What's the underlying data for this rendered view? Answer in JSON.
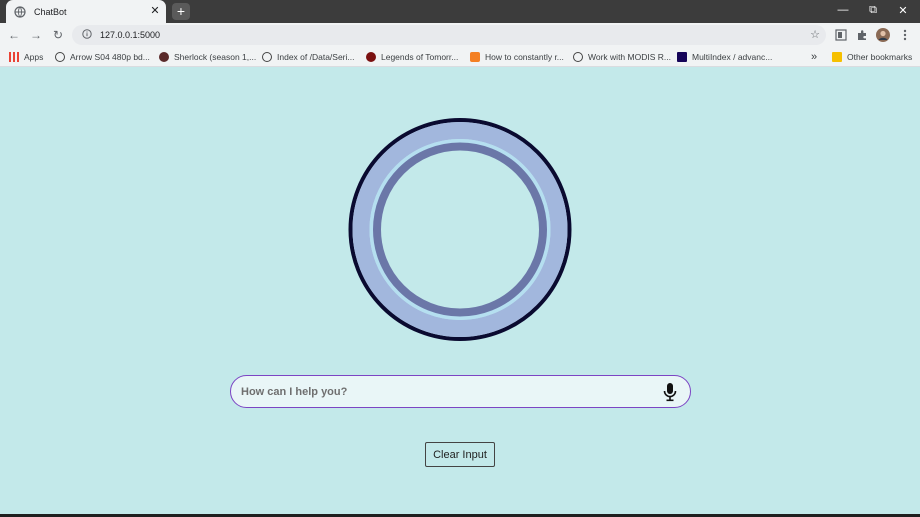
{
  "browser": {
    "tab_title": "ChatBot",
    "new_tab_symbol": "+",
    "url": "127.0.0.1:5000",
    "bookmarks": [
      {
        "label": "Apps",
        "icon": "apps-grid-icon"
      },
      {
        "label": "Arrow S04 480p bd...",
        "icon": "globe-icon"
      },
      {
        "label": "Sherlock (season 1,...",
        "icon": "site-icon"
      },
      {
        "label": "Index of /Data/Seri...",
        "icon": "globe-icon"
      },
      {
        "label": "Legends of Tomorr...",
        "icon": "site-icon"
      },
      {
        "label": "How to constantly r...",
        "icon": "stackoverflow-icon"
      },
      {
        "label": "Work with MODIS R...",
        "icon": "globe-icon"
      },
      {
        "label": "MultiIndex / advanc...",
        "icon": "pandas-icon"
      }
    ],
    "overflow_symbol": "»",
    "other_bookmarks": "Other bookmarks"
  },
  "app": {
    "search_placeholder": "How can I help you?",
    "clear_button": "Clear Input",
    "orb_colors": {
      "outer_ring": "#0a0a30",
      "band": "#a2b7dd",
      "gap": "#b5dff0",
      "inner_ring": "#6b77a8"
    }
  }
}
